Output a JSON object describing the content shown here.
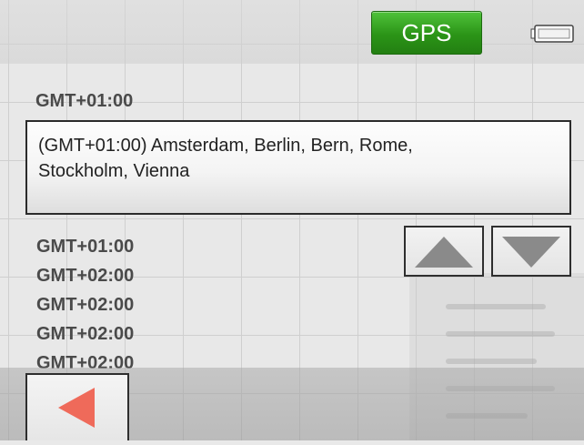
{
  "header": {
    "gps_label": "GPS",
    "gps_color": "#2b9417",
    "battery_icon": "battery-icon"
  },
  "current_offset": "GMT+01:00",
  "selected_zone": {
    "line1": "(GMT+01:00) Amsterdam, Berlin, Bern, Rome,",
    "line2": "Stockholm, Vienna"
  },
  "zone_list": [
    "GMT+01:00",
    "GMT+02:00",
    "GMT+02:00",
    "GMT+02:00",
    "GMT+02:00"
  ],
  "controls": {
    "scroll_up_icon": "arrow-up-icon",
    "scroll_down_icon": "arrow-down-icon",
    "back_icon": "arrow-left-icon",
    "back_color": "#ef6a5a"
  }
}
